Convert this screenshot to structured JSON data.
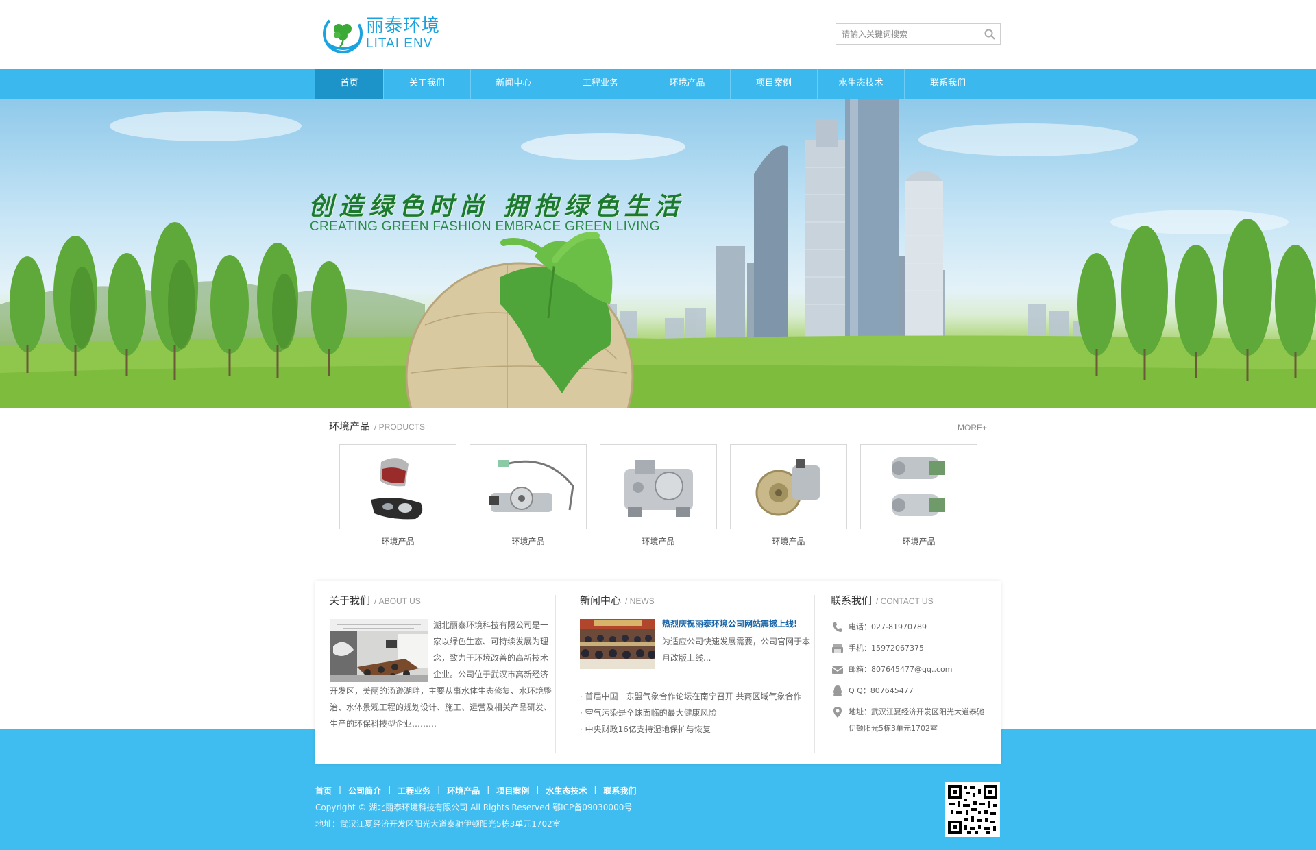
{
  "brand": {
    "name_cn": "丽泰环境",
    "name_en": "LITAI ENV"
  },
  "search": {
    "placeholder": "请输入关键词搜索"
  },
  "nav": {
    "items": [
      {
        "label": "首页",
        "active": true
      },
      {
        "label": "关于我们"
      },
      {
        "label": "新闻中心"
      },
      {
        "label": "工程业务"
      },
      {
        "label": "环境产品"
      },
      {
        "label": "项目案例"
      },
      {
        "label": "水生态技术"
      },
      {
        "label": "联系我们"
      }
    ]
  },
  "banner": {
    "slogan_cn": "创造绿色时尚 拥抱绿色生活",
    "slogan_en": "CREATING GREEN FASHION EMBRACE GREEN LIVING"
  },
  "products": {
    "title": "环境产品",
    "subtitle": "/ PRODUCTS",
    "more": "MORE+",
    "items": [
      {
        "label": "环境产品"
      },
      {
        "label": "环境产品"
      },
      {
        "label": "环境产品"
      },
      {
        "label": "环境产品"
      },
      {
        "label": "环境产品"
      }
    ]
  },
  "about": {
    "title": "关于我们",
    "subtitle": "/ ABOUT US",
    "text": "湖北丽泰环境科技有限公司是一家以绿色生态、可持续发展为理念，致力于环境改善的高新技术企业。公司位于武汉市高新经济开发区，美丽的汤逊湖畔，主要从事水体生态修复、水环境整治、水体景观工程的规划设计、施工、运营及相关产品研发、生产的环保科技型企业………"
  },
  "news": {
    "title": "新闻中心",
    "subtitle": "/ NEWS",
    "headline": "热烈庆祝丽泰环境公司网站震撼上线!",
    "headline_desc": "为适应公司快速发展需要，公司官网于本月改版上线...",
    "items": [
      "· 首届中国一东盟气象合作论坛在南宁召开 共商区域气象合作",
      "· 空气污染是全球面临的最大健康风险",
      "· 中央财政16亿支持湿地保护与恢复"
    ]
  },
  "contact": {
    "title": "联系我们",
    "subtitle": "/ CONTACT US",
    "phone": "电话：027-81970789",
    "mobile": "手机：15972067375",
    "email": "邮箱：807645477@qq..com",
    "qq": "Q  Q：807645477",
    "address": "地址：武汉江夏经济开发区阳光大道泰驰伊顿阳光5栋3单元1702室"
  },
  "footer": {
    "links": [
      "首页",
      "公司简介",
      "工程业务",
      "环境产品",
      "项目案例",
      "水生态技术",
      "联系我们"
    ],
    "copyright": "Copyright ©  湖北丽泰环境科技有限公司  All Rights Reserved  鄂ICP备09030000号",
    "address": "地址：武汉江夏经济开发区阳光大道泰驰伊顿阳光5栋3单元1702室"
  },
  "colors": {
    "primary": "#3bb9ee",
    "nav_active": "#1d94c9",
    "footer": "#40bdf0",
    "headline": "#1b66a8",
    "slogan": "#1c7a2f"
  }
}
